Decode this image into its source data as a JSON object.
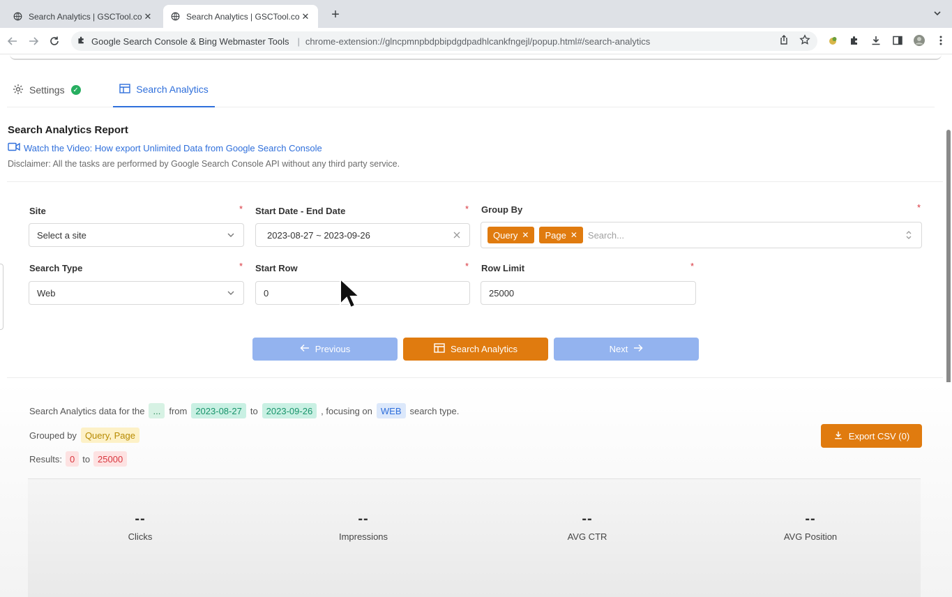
{
  "browser": {
    "tabs": [
      {
        "title": "Search Analytics | GSCTool.co",
        "active": false
      },
      {
        "title": "Search Analytics | GSCTool.co",
        "active": true
      }
    ],
    "omnibox": {
      "extension_name": "Google Search Console & Bing Webmaster Tools",
      "url": "chrome-extension://glncpmnpbdpbipdgdpadhlcankfngejl/popup.html#/search-analytics"
    }
  },
  "page_tabs": [
    {
      "label": "Settings",
      "icon": "gear-icon",
      "status": "check-circle-icon"
    },
    {
      "label": "Search Analytics",
      "icon": "table-icon",
      "active": true
    }
  ],
  "report": {
    "title": "Search Analytics Report",
    "video_link": "Watch the Video: How export Unlimited Data from Google Search Console",
    "disclaimer": "Disclaimer: All the tasks are performed by Google Search Console API without any third party service."
  },
  "form": {
    "site": {
      "label": "Site",
      "value": "Select a site"
    },
    "date_range": {
      "label": "Start Date - End Date",
      "value": "2023-08-27 ~ 2023-09-26"
    },
    "group_by": {
      "label": "Group By",
      "chips": [
        "Query",
        "Page"
      ],
      "placeholder": "Search..."
    },
    "search_type": {
      "label": "Search Type",
      "value": "Web"
    },
    "start_row": {
      "label": "Start Row",
      "value": "0"
    },
    "row_limit": {
      "label": "Row Limit",
      "value": "25000"
    },
    "required_mark": "*"
  },
  "buttons": {
    "previous": "Previous",
    "search": "Search Analytics",
    "next": "Next",
    "export": "Export CSV (0)"
  },
  "summary": {
    "prefix": "Search Analytics data for the",
    "site": "...",
    "from": "from",
    "start": "2023-08-27",
    "to": "to",
    "end": "2023-09-26",
    "focusing": ", focusing on",
    "type": "WEB",
    "suffix": "search type.",
    "grouped_label": "Grouped by",
    "grouped_value": "Query, Page",
    "results_label": "Results:",
    "results_from": "0",
    "results_to_word": "to",
    "results_to": "25000"
  },
  "stats": [
    {
      "value": "--",
      "label": "Clicks"
    },
    {
      "value": "--",
      "label": "Impressions"
    },
    {
      "value": "--",
      "label": "AVG CTR"
    },
    {
      "value": "--",
      "label": "AVG Position"
    }
  ],
  "colors": {
    "accent_orange": "#e07b0f",
    "accent_blue": "#2f6fdb",
    "success_green": "#27ae60",
    "required_red": "#d9363e"
  }
}
